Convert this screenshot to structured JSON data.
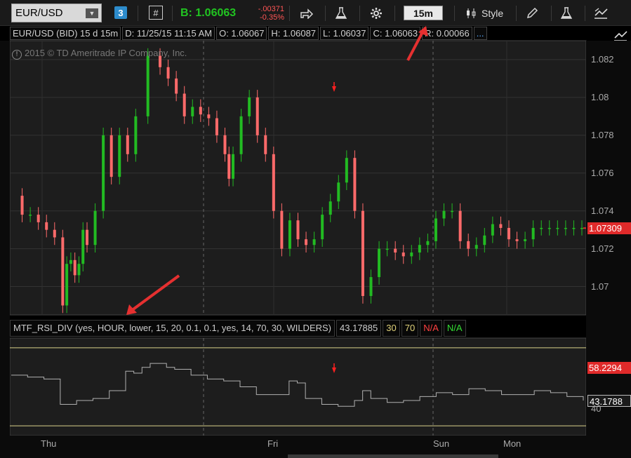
{
  "toolbar": {
    "symbol": "EUR/USD",
    "link_badge": "3",
    "hash": "#",
    "bid": "B: 1.06063",
    "change": "-.00371",
    "change_pct": "-0.35%",
    "timeframe": "15m",
    "style_label": "Style"
  },
  "header": {
    "title": "EUR/USD (BID) 15 d 15m",
    "date": "D: 11/25/15 11:15 AM",
    "open": "O: 1.06067",
    "high": "H: 1.06087",
    "low": "L: 1.06037",
    "close": "C: 1.06063",
    "range": "R: 0.00066",
    "more": "..."
  },
  "copyright": "2015 © TD Ameritrade IP Company, Inc.",
  "price_axis": {
    "ticks": [
      "1.082",
      "1.08",
      "1.078",
      "1.076",
      "1.074",
      "1.072",
      "1.07"
    ],
    "current_price": "1.07309"
  },
  "study": {
    "label": "MTF_RSI_DIV (yes, HOUR, lower, 15, 20, 0.1, 0.1, yes, 14, 70, 30, WILDERS)",
    "value": "43.17885",
    "level_low": "30",
    "level_high": "70",
    "na_red": "N/A",
    "na_green": "N/A",
    "upper_label": "58.2294",
    "lower_label": "43.1788",
    "tick_40": "40"
  },
  "time_axis": {
    "labels": [
      "Thu",
      "Fri",
      "Sun",
      "Mon"
    ]
  },
  "colors": {
    "up": "#22bb22",
    "down": "#ff6a6a",
    "rsi_line": "#b0b0b0",
    "rsi_bounds": "#d9d28a",
    "marker": "#ff2020"
  },
  "chart_data": [
    {
      "type": "line",
      "title": "EUR/USD (BID) 15 d 15m",
      "description_series": "candlestick-close",
      "x": [
        0,
        2,
        4,
        6,
        8,
        10,
        12,
        13,
        14,
        15,
        16,
        17,
        18,
        20,
        22,
        24,
        26,
        28,
        30,
        33,
        36,
        38,
        40,
        42,
        44,
        46,
        48,
        50,
        52,
        53,
        54,
        56,
        58,
        60,
        62,
        64,
        66,
        68,
        70,
        72,
        74,
        76,
        78,
        80,
        82,
        84,
        86,
        88,
        90,
        92,
        94,
        96,
        98,
        100,
        102,
        104,
        106,
        108,
        110,
        112,
        114,
        116,
        118,
        120,
        122,
        124,
        126,
        128,
        130,
        132,
        134,
        136,
        138,
        140
      ],
      "values": [
        1.0748,
        1.0738,
        1.0738,
        1.0734,
        1.073,
        1.0726,
        1.069,
        1.0712,
        1.0714,
        1.0706,
        1.0712,
        1.073,
        1.0722,
        1.074,
        1.078,
        1.0758,
        1.078,
        1.077,
        1.079,
        1.0822,
        1.0816,
        1.081,
        1.0802,
        1.079,
        1.0795,
        1.0791,
        1.0789,
        1.078,
        1.077,
        1.0757,
        1.077,
        1.079,
        1.08,
        1.078,
        1.077,
        1.074,
        1.072,
        1.0735,
        1.0725,
        1.0722,
        1.0725,
        1.0738,
        1.0745,
        1.0755,
        1.0768,
        1.074,
        1.0695,
        1.0705,
        1.072,
        1.072,
        1.0718,
        1.0716,
        1.0718,
        1.0722,
        1.0724,
        1.0736,
        1.074,
        1.074,
        1.0724,
        1.072,
        1.0722,
        1.0727,
        1.0733,
        1.0731,
        1.0725,
        1.0724,
        1.0725,
        1.0731,
        1.0731,
        1.0731,
        1.0731,
        1.0731,
        1.0731,
        1.0731
      ],
      "ylim": [
        1.0685,
        1.083
      ],
      "yticks": [
        1.07,
        1.072,
        1.074,
        1.076,
        1.078,
        1.08,
        1.082
      ],
      "grid": true
    },
    {
      "type": "line",
      "title": "MTF_RSI_DIV",
      "x": [
        0,
        4,
        8,
        12,
        16,
        20,
        24,
        28,
        30,
        32,
        34,
        36,
        38,
        40,
        44,
        48,
        52,
        56,
        60,
        64,
        68,
        70,
        72,
        76,
        80,
        84,
        86,
        88,
        92,
        96,
        100,
        104,
        108,
        112,
        116,
        120,
        124,
        128,
        132,
        136,
        140
      ],
      "values": [
        56,
        55,
        54,
        41,
        43,
        44,
        48,
        58,
        57,
        60,
        62,
        62,
        60,
        59,
        56,
        54,
        53,
        50,
        46,
        46,
        53,
        52,
        44,
        41,
        40,
        43,
        48,
        44,
        42,
        43,
        45,
        47,
        46,
        49,
        48,
        46,
        46,
        48,
        47,
        45,
        43
      ],
      "ylim": [
        25,
        75
      ],
      "bounds": [
        30,
        70
      ],
      "grid": false
    }
  ]
}
